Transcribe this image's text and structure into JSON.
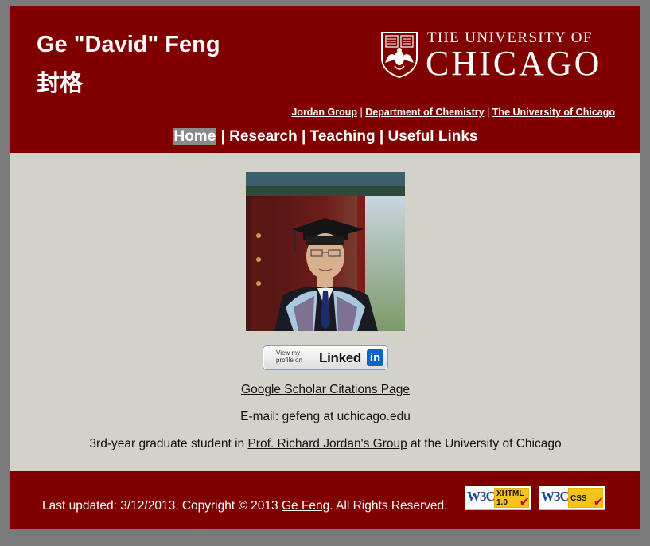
{
  "header": {
    "name": "Ge \"David\" Feng",
    "name_cn": "封格",
    "university_logo": {
      "line1": "THE UNIVERSITY OF",
      "line2": "CHICAGO",
      "icon": "phoenix-crest-icon"
    },
    "sublinks": [
      {
        "label": "Jordan Group"
      },
      {
        "label": "Department of Chemistry"
      },
      {
        "label": "The University of Chicago"
      }
    ],
    "separator": "|",
    "nav": [
      {
        "label": "Home",
        "active": true
      },
      {
        "label": "Research"
      },
      {
        "label": "Teaching"
      },
      {
        "label": "Useful Links"
      }
    ]
  },
  "main": {
    "photo_icon": "profile-photo",
    "linkedin": {
      "small_text": "View my profile on",
      "brand": "Linked",
      "brand_box": "in"
    },
    "scholar_link": "Google Scholar Citations Page",
    "email": "E-mail: gefeng at uchicago.edu",
    "bio": {
      "before": "3rd-year graduate student in ",
      "link": "Prof. Richard Jordan's Group",
      "after": " at the University of Chicago"
    }
  },
  "footer": {
    "text_before": "Last updated: 3/12/2013. Copyright © 2013 ",
    "author_link": "Ge Feng",
    "text_after": ". All Rights Reserved.",
    "badges": [
      {
        "w3c": "W3C",
        "label_line1": "XHTML",
        "label_line2": "1.0"
      },
      {
        "w3c": "W3C",
        "label_line1": "CSS",
        "label_line2": ""
      }
    ]
  },
  "colors": {
    "maroon": "#800000",
    "content_bg": "#d3d2ca",
    "outer_bg": "#7a7a7a"
  }
}
